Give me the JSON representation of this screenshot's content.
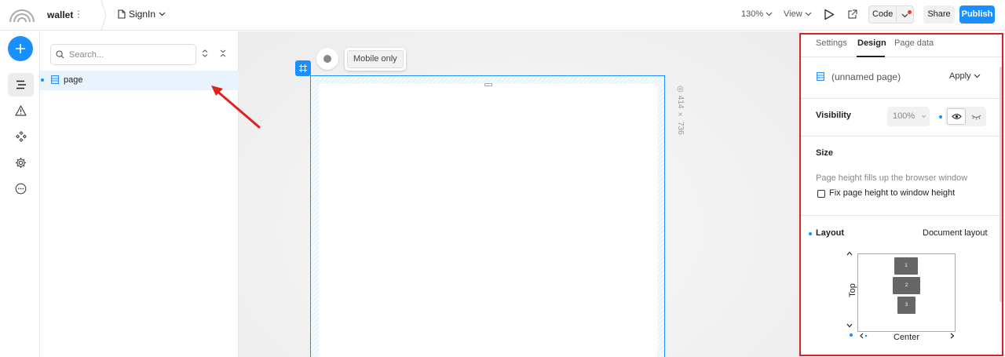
{
  "topbar": {
    "app_name": "wallet",
    "app_menu": "⋮",
    "page_name": "SignIn",
    "zoom": "130%",
    "view": "View",
    "code_label": "Code",
    "share_label": "Share",
    "publish_label": "Publish"
  },
  "rail": {
    "items": [
      "add-icon",
      "layers-icon",
      "warning-icon",
      "components-icon",
      "settings-icon",
      "more-icon"
    ]
  },
  "layers": {
    "search_placeholder": "Search...",
    "items": [
      {
        "label": "page",
        "icon": "page-icon"
      }
    ]
  },
  "canvas": {
    "chip_label": "Mobile only",
    "frame_size_label": "414 × 736"
  },
  "right_panel": {
    "tabs": [
      {
        "label": "Settings",
        "active": false
      },
      {
        "label": "Design",
        "active": true
      },
      {
        "label": "Page data",
        "active": false
      }
    ],
    "page_name": "(unnamed page)",
    "apply_label": "Apply",
    "visibility": {
      "label": "Visibility",
      "opacity": "100%"
    },
    "size": {
      "label": "Size",
      "description": "Page height fills up the browser window",
      "checkbox_label": "Fix page height to window height",
      "checked": false
    },
    "layout": {
      "label": "Layout",
      "value": "Document layout",
      "blocks": [
        "1",
        "2",
        "3"
      ],
      "vertical_label": "Top",
      "horizontal_label": "Center"
    }
  },
  "colors": {
    "accent": "#1a8fff",
    "highlight_outline": "#e01f1f",
    "annotation_arrow": "#e01f1f"
  }
}
